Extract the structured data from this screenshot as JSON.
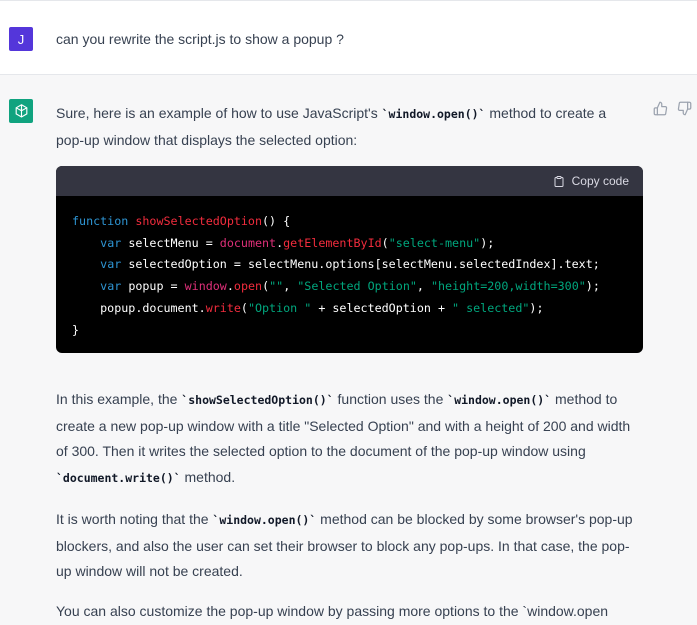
{
  "user": {
    "avatar_initial": "J",
    "message": "can you rewrite the script.js to show a popup ?"
  },
  "assistant": {
    "intro_a": "Sure, here is an example of how to use JavaScript's ",
    "intro_code": "`window.open()`",
    "intro_b": " method to create a pop-up window that displays the selected option:",
    "copy_label": "Copy code",
    "code_lines": [
      "function showSelectedOption() {",
      "    var selectMenu = document.getElementById(\"select-menu\");",
      "    var selectedOption = selectMenu.options[selectMenu.selectedIndex].text;",
      "    var popup = window.open(\"\", \"Selected Option\", \"height=200,width=300\");",
      "    popup.document.write(\"Option \" + selectedOption + \" selected\");",
      "}"
    ],
    "p1_a": "In this example, the ",
    "p1_code1": "`showSelectedOption()`",
    "p1_b": " function uses the ",
    "p1_code2": "`window.open()`",
    "p1_c": " method to create a new pop-up window with a title \"Selected Option\" and with a height of 200 and width of 300. Then it writes the selected option to the document of the pop-up window using ",
    "p1_code3": "`document.write()`",
    "p1_d": " method.",
    "p2_a": "It is worth noting that the ",
    "p2_code": "`window.open()`",
    "p2_b": " method can be blocked by some browser's pop-up blockers, and also the user can set their browser to block any pop-ups. In that case, the pop-up window will not be created.",
    "p3": "You can also customize the pop-up window by passing more options to the `window.open"
  },
  "colors": {
    "user_avatar": "#5436da",
    "bot_avatar": "#10a37f",
    "code_bg": "#000000",
    "code_header_bg": "#343541",
    "keyword": "#2e95d3",
    "function_name": "#f22c3d",
    "string": "#00a67d",
    "property": "#df3079"
  }
}
